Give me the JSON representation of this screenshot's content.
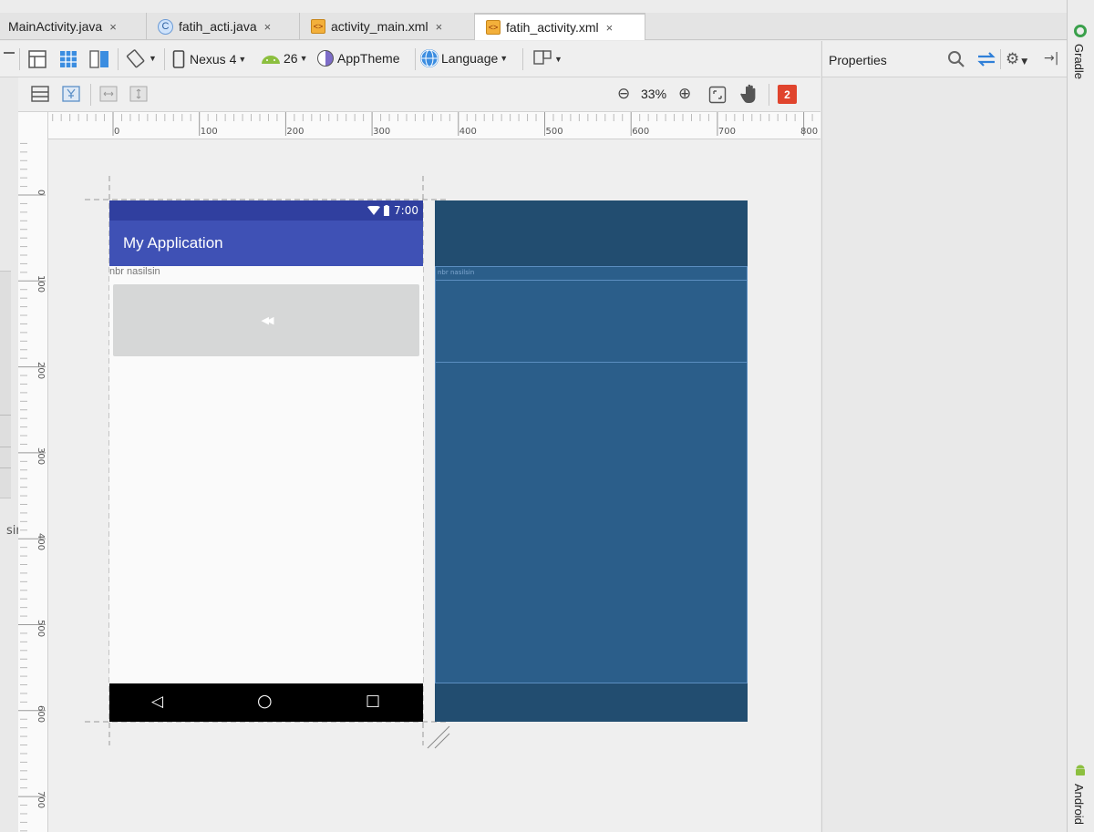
{
  "tabs": [
    {
      "label": "MainActivity.java",
      "icon": "java-class-icon"
    },
    {
      "label": "fatih_acti.java",
      "icon": "java-class-icon"
    },
    {
      "label": "activity_main.xml",
      "icon": "xml-file-icon"
    },
    {
      "label": "fatih_activity.xml",
      "icon": "xml-file-icon",
      "active": true
    }
  ],
  "tab_close": "×",
  "toolbar": {
    "device": "Nexus 4",
    "api": "26",
    "theme": "AppTheme",
    "language": "Language"
  },
  "zoom": {
    "value": "33%",
    "minus": "⊖",
    "plus": "⊕"
  },
  "error_badge": "2",
  "properties": {
    "title": "Properties"
  },
  "side_panels": {
    "gradle": "Gradle",
    "android": "Android"
  },
  "ruler": {
    "h_ticks": [
      "0",
      "100",
      "200",
      "300",
      "400",
      "500",
      "600",
      "700",
      "800"
    ],
    "v_ticks": [
      "0",
      "100",
      "200",
      "300",
      "400",
      "500",
      "600",
      "700"
    ]
  },
  "left_clip": "sir",
  "design": {
    "status_time": "7:00",
    "app_title": "My Application",
    "text_view": "nbr nasilsin",
    "image_button_glyph": "◀◀",
    "nav": {
      "back": "◁",
      "home": "○",
      "recents": "□"
    }
  },
  "blueprint": {
    "text_view": "nbr nasilsin"
  },
  "colors": {
    "primary": "#3f51b5",
    "primary_dark": "#303f9f",
    "blueprint": "#224d70",
    "error": "#e0442d"
  }
}
